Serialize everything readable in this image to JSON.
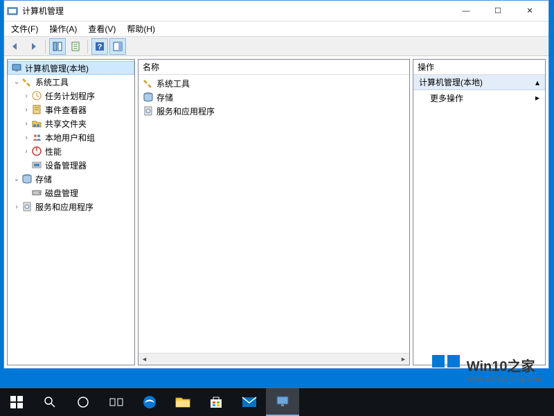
{
  "window": {
    "title": "计算机管理",
    "controls": {
      "min": "—",
      "max": "☐",
      "close": "✕"
    }
  },
  "menubar": {
    "file": "文件(F)",
    "action": "操作(A)",
    "view": "查看(V)",
    "help": "帮助(H)"
  },
  "tree": {
    "root": "计算机管理(本地)",
    "system_tools": "系统工具",
    "task_scheduler": "任务计划程序",
    "event_viewer": "事件查看器",
    "shared_folders": "共享文件夹",
    "local_users_groups": "本地用户和组",
    "performance": "性能",
    "device_manager": "设备管理器",
    "storage": "存储",
    "disk_management": "磁盘管理",
    "services_apps": "服务和应用程序"
  },
  "list": {
    "header_name": "名称",
    "items": [
      {
        "label": "系统工具"
      },
      {
        "label": "存储"
      },
      {
        "label": "服务和应用程序"
      }
    ]
  },
  "actions": {
    "header": "操作",
    "section_title": "计算机管理(本地)",
    "more_actions": "更多操作"
  },
  "watermark": {
    "title": "Win10之家",
    "url": "www.win10xitong.com"
  }
}
